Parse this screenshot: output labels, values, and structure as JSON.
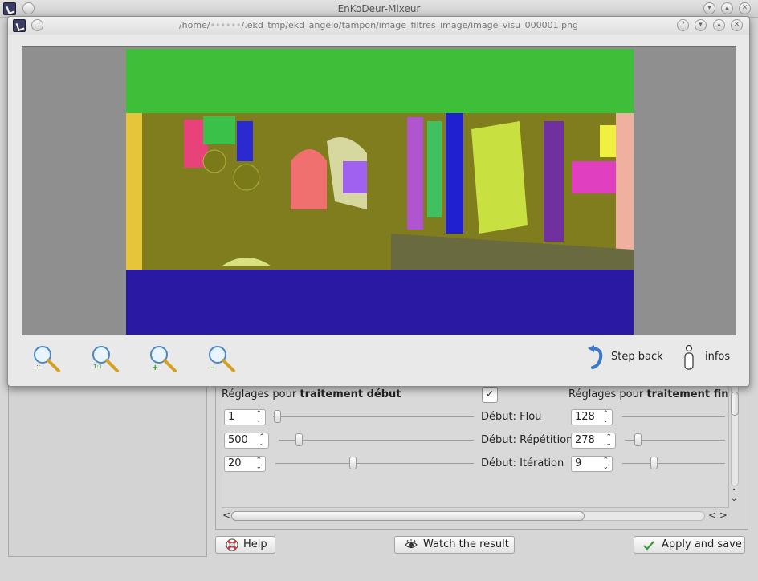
{
  "main_window": {
    "title": "EnKoDeur-Mixeur",
    "controls": [
      "–",
      "▾",
      "▴",
      "✕"
    ]
  },
  "viewer": {
    "path": "/home/",
    "path_blurred": "••••••",
    "path_rest": "/.ekd_tmp/ekd_angelo/tampon/image_filtres_image/image_visu_000001.png",
    "controls": [
      "?",
      "▾",
      "▴",
      "✕"
    ],
    "zoom_labels": [
      "::",
      "1:1",
      "+",
      "–"
    ],
    "step_back": "Step back",
    "infos": "infos"
  },
  "settings": {
    "start_heading_prefix": "Réglages pour ",
    "start_heading_bold": "traitement début",
    "end_heading_prefix": "Réglages pour ",
    "end_heading_bold": "traitement fin",
    "check": "✓",
    "rows": [
      {
        "start_value": "1",
        "label": "Début: Flou",
        "end_value": "128"
      },
      {
        "start_value": "500",
        "label": "Début: Répétition",
        "end_value": "278"
      },
      {
        "start_value": "20",
        "label": "Début: Itération",
        "end_value": "9"
      }
    ],
    "scroll_left": "<",
    "scroll_right": "< >",
    "scroll_up": "⌃",
    "scroll_down": "⌄"
  },
  "buttons": {
    "help": "Help",
    "watch": "Watch the result",
    "apply": "Apply and save"
  },
  "colors": {
    "green_band": "#3fbe3a",
    "olive_band": "#7f7d1e",
    "blue_band": "#2a1aa3"
  }
}
